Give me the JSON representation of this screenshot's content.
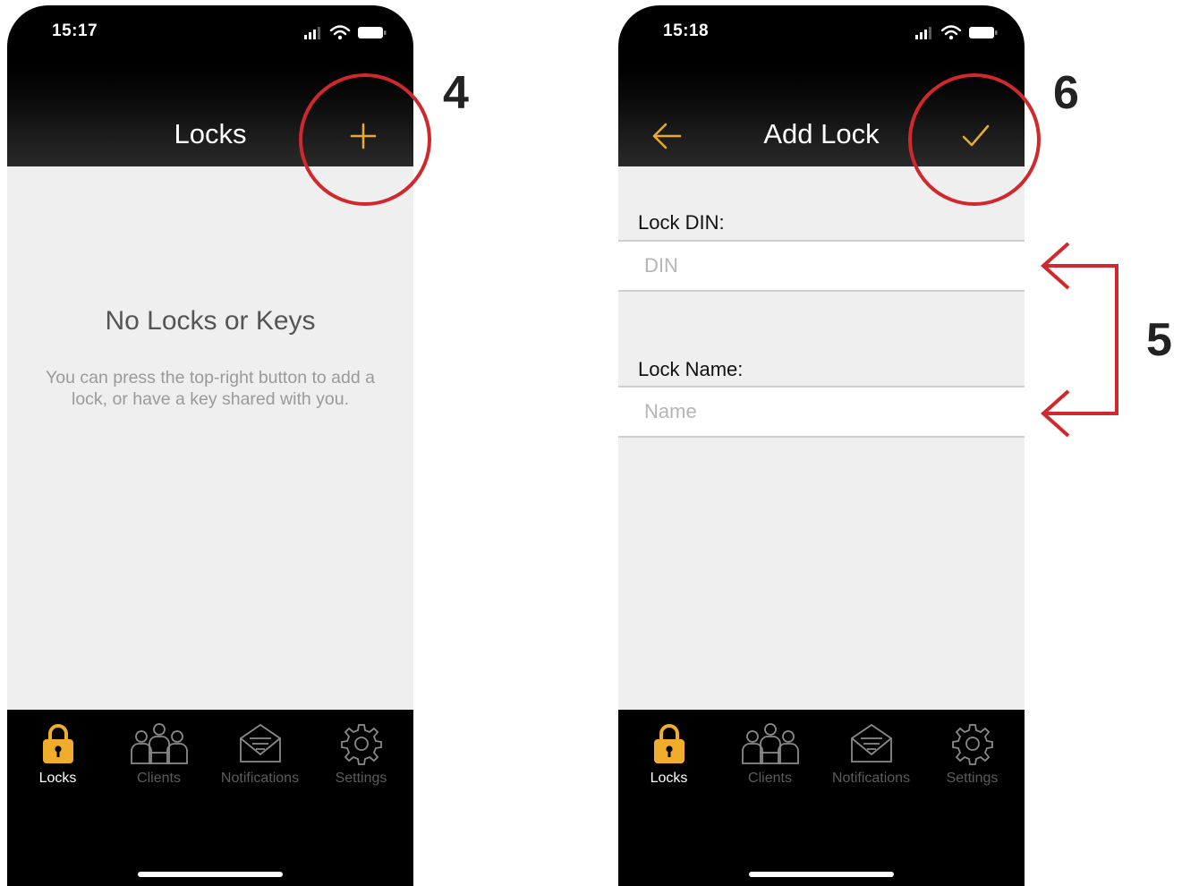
{
  "left_screen": {
    "status_time": "15:17",
    "nav_title": "Locks",
    "add_icon": "plus-icon",
    "empty_title": "No Locks or Keys",
    "empty_desc": "You can press the top-right button to add a lock, or have a key shared with you."
  },
  "right_screen": {
    "status_time": "15:18",
    "nav_title": "Add Lock",
    "back_icon": "arrow-left-icon",
    "confirm_icon": "checkmark-icon",
    "din_label": "Lock DIN:",
    "din_placeholder": "DIN",
    "name_label": "Lock Name:",
    "name_placeholder": "Name"
  },
  "tabs": [
    {
      "label": "Locks",
      "icon": "lock-icon",
      "active": true
    },
    {
      "label": "Clients",
      "icon": "clients-icon",
      "active": false
    },
    {
      "label": "Notifications",
      "icon": "envelope-icon",
      "active": false
    },
    {
      "label": "Settings",
      "icon": "gear-icon",
      "active": false
    }
  ],
  "annotations": {
    "step_add": "4",
    "step_fields": "5",
    "step_confirm": "6"
  },
  "colors": {
    "accent": "#e8a92c",
    "callout": "#d0282c",
    "nav_background": "#000000",
    "content_background": "#efefef"
  }
}
